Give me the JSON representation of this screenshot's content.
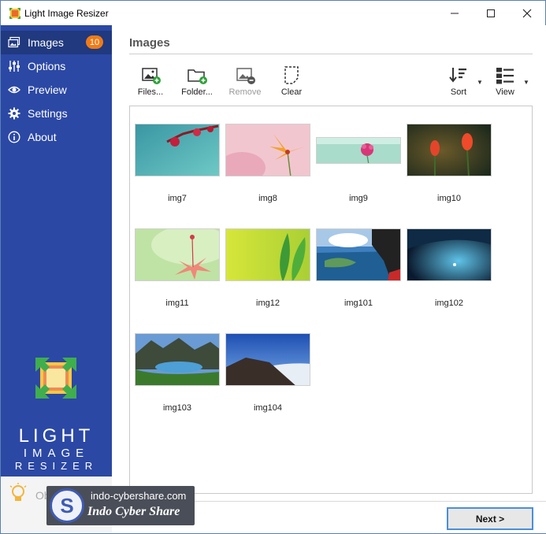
{
  "window": {
    "title": "Light Image Resizer"
  },
  "sidebar": {
    "items": [
      {
        "label": "Images",
        "icon": "images-icon",
        "badge": "10",
        "active": true
      },
      {
        "label": "Options",
        "icon": "sliders-icon"
      },
      {
        "label": "Preview",
        "icon": "eye-icon"
      },
      {
        "label": "Settings",
        "icon": "gear-icon"
      },
      {
        "label": "About",
        "icon": "info-icon"
      }
    ],
    "brand": {
      "line1": "LIGHT",
      "line2": "IMAGE",
      "line3": "RESIZER"
    },
    "footer_text": "ObviousIdea"
  },
  "main": {
    "title": "Images",
    "toolbar": {
      "files": "Files...",
      "folder": "Folder...",
      "remove": "Remove",
      "clear": "Clear",
      "sort": "Sort",
      "view": "View"
    },
    "images": [
      {
        "name": "img7"
      },
      {
        "name": "img8"
      },
      {
        "name": "img9"
      },
      {
        "name": "img10"
      },
      {
        "name": "img11"
      },
      {
        "name": "img12"
      },
      {
        "name": "img101"
      },
      {
        "name": "img102"
      },
      {
        "name": "img103"
      },
      {
        "name": "img104"
      }
    ],
    "next_button": "Next >"
  },
  "watermark": {
    "url": "indo-cybershare.com",
    "name": "Indo Cyber Share",
    "logo_letter": "S"
  },
  "colors": {
    "sidebar": "#2b48a4",
    "sidebar_active": "#20397f",
    "badge": "#f07b16",
    "next_border": "#4d8ed8"
  }
}
